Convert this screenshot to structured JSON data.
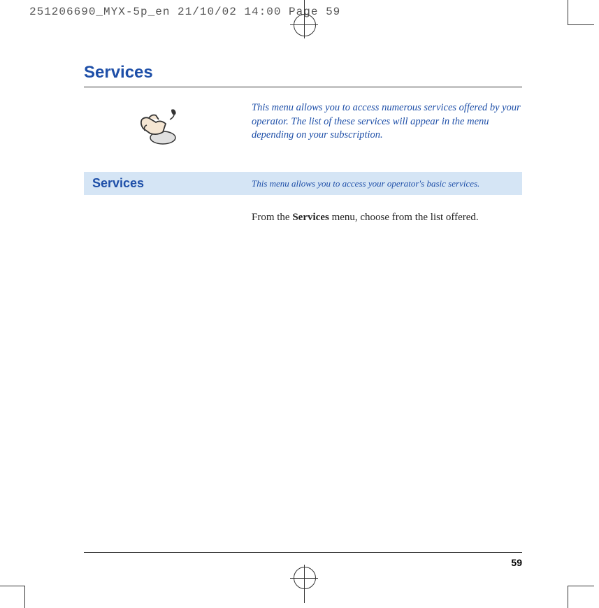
{
  "header": {
    "line": "251206690_MYX-5p_en  21/10/02  14:00  Page 59"
  },
  "page": {
    "title": "Services",
    "intro": "This menu allows you to access numerous services offered by your operator. The list of these services will appear in the menu depending on your subscription.",
    "subsection": {
      "label": "Services",
      "description": "This menu allows you to access your operator's basic services."
    },
    "body": {
      "prefix": "From the ",
      "bold": "Services",
      "suffix": " menu, choose from the list offered."
    },
    "page_number": "59"
  }
}
